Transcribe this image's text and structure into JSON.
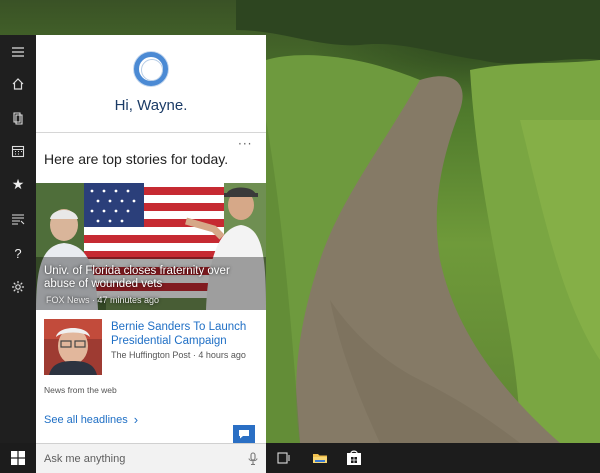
{
  "cortana": {
    "greeting": "Hi, Wayne."
  },
  "feed": {
    "section_title": "Here are top stories for today.",
    "more_glyph": "···",
    "hero": {
      "title": "Univ. of Florida closes fraternity over abuse of wounded vets",
      "source": "FOX News · 47 minutes ago"
    },
    "story2": {
      "title": "Bernie Sanders To Launch Presidential Campaign",
      "source": "The Huffington Post · 4 hours ago"
    },
    "news_from_web": "News from the web",
    "see_all": "See all headlines",
    "see_all_chevron": "›"
  },
  "taskbar": {
    "search_placeholder": "Ask me anything"
  },
  "icons": {
    "rail": [
      "hamburger-icon",
      "home-icon",
      "notebook-icon",
      "calendar-icon",
      "star-icon",
      "news-icon",
      "help-icon",
      "settings-icon"
    ],
    "rail_glyphs": {
      "star": "★",
      "help": "?"
    },
    "taskbar": [
      "windows-logo-icon",
      "microphone-icon",
      "task-view-icon",
      "file-explorer-icon",
      "store-icon"
    ]
  },
  "colors": {
    "accent": "#2a6fc4",
    "link": "#1f6fc5",
    "cortana_ring": "#4b8ad4",
    "rail_bg": "#1f1f1f",
    "taskbar_bg": "#1c1c1c"
  }
}
